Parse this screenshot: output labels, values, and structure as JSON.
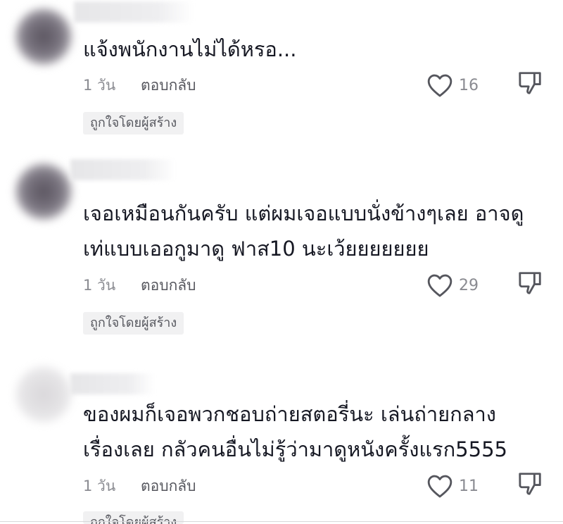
{
  "comments": [
    {
      "text": "แจ้งพนักงานไม่ได้หรอ...",
      "time": "1 วัน",
      "reply_label": "ตอบกลับ",
      "likes": "16",
      "badge": "ถูกใจโดยผู้สร้าง"
    },
    {
      "text": "เจอเหมือนกันครับ แต่ผมเจอแบบนั่งข้างๆเลย อาจดู\nเท่แบบเออกูมาดู ฟาส10 นะเว้ยยยยยยย",
      "time": "1 วัน",
      "reply_label": "ตอบกลับ",
      "likes": "29",
      "badge": "ถูกใจโดยผู้สร้าง"
    },
    {
      "text": "ของผมก็เจอพวกชอบถ่ายสตอรี่นะ เล่นถ่ายกลาง\nเรื่องเลย กลัวคนอื่นไม่รู้ว่ามาดูหนังครั้งแรก5555",
      "time": "1 วัน",
      "reply_label": "ตอบกลับ",
      "likes": "11",
      "badge": "ถูกใจโดยผู้สร้าง"
    }
  ],
  "icons": {
    "like": "heart-outline-icon",
    "dislike": "thumbs-down-icon"
  },
  "colors": {
    "text": "#161823",
    "muted": "#8a8b91",
    "badge_bg": "#f1f1f2"
  }
}
